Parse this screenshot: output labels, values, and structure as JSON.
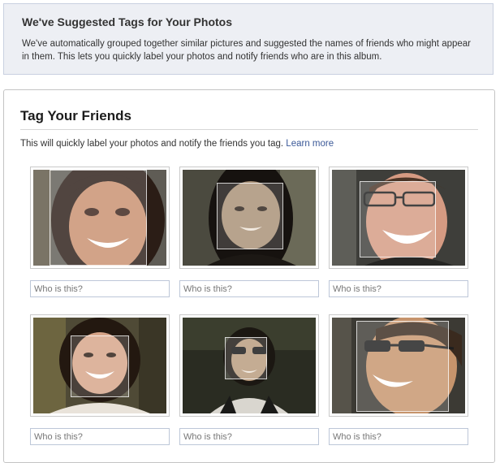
{
  "suggestion_notice": {
    "title": "We've Suggested Tags for Your Photos",
    "text": "We've automatically grouped together similar pictures and suggested the names of friends who might appear in them. This lets you quickly label your photos and notify friends who are in this album."
  },
  "tag_panel": {
    "title": "Tag Your Friends",
    "subtitle": "This will quickly label your photos and notify the friends you tag.",
    "learn_more": "Learn more"
  },
  "photos": [
    {
      "placeholder": "Who is this?",
      "value": ""
    },
    {
      "placeholder": "Who is this?",
      "value": ""
    },
    {
      "placeholder": "Who is this?",
      "value": ""
    },
    {
      "placeholder": "Who is this?",
      "value": ""
    },
    {
      "placeholder": "Who is this?",
      "value": ""
    },
    {
      "placeholder": "Who is this?",
      "value": ""
    }
  ],
  "colors": {
    "notice_background": "#edeff4",
    "link": "#3b5998",
    "input_border": "#bdc7d8"
  }
}
